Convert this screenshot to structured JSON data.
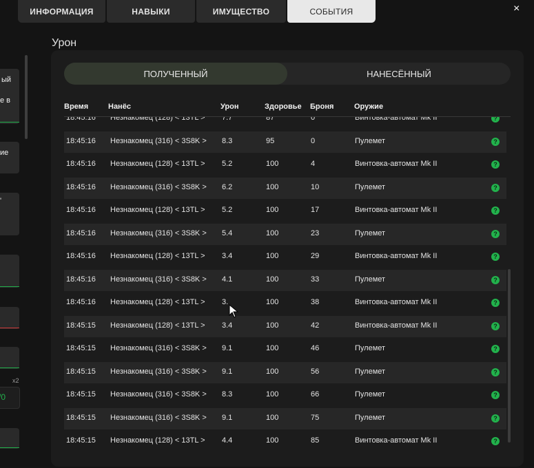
{
  "tabs": [
    {
      "label": "ИНФОРМАЦИЯ"
    },
    {
      "label": "НАВЫКИ"
    },
    {
      "label": "ИМУЩЕСТВО"
    },
    {
      "label": "СОБЫТИЯ",
      "active": true
    }
  ],
  "close_label": "×",
  "left_panel": {
    "snippets": [
      "ый",
      "е в",
      "ие",
      "'",
      "x2",
      "/0"
    ]
  },
  "section_title": "Урон",
  "segment": [
    {
      "label": "ПОЛУЧЕННЫЙ",
      "active": true
    },
    {
      "label": "НАНЕСЁННЫЙ",
      "active": false
    }
  ],
  "columns": [
    "Время",
    "Нанёс",
    "Урон",
    "Здоровье",
    "Броня",
    "Оружие"
  ],
  "rows": [
    {
      "time": "18:45:16",
      "attacker": "Незнакомец (128) < 13TL >",
      "damage": "7.7",
      "health": "87",
      "armor": "0",
      "weapon": "Винтовка-автомат Mk II"
    },
    {
      "time": "18:45:16",
      "attacker": "Незнакомец (316) < 3S8K >",
      "damage": "8.3",
      "health": "95",
      "armor": "0",
      "weapon": "Пулемет"
    },
    {
      "time": "18:45:16",
      "attacker": "Незнакомец (128) < 13TL >",
      "damage": "5.2",
      "health": "100",
      "armor": "4",
      "weapon": "Винтовка-автомат Mk II"
    },
    {
      "time": "18:45:16",
      "attacker": "Незнакомец (316) < 3S8K >",
      "damage": "6.2",
      "health": "100",
      "armor": "10",
      "weapon": "Пулемет"
    },
    {
      "time": "18:45:16",
      "attacker": "Незнакомец (128) < 13TL >",
      "damage": "5.2",
      "health": "100",
      "armor": "17",
      "weapon": "Винтовка-автомат Mk II"
    },
    {
      "time": "18:45:16",
      "attacker": "Незнакомец (316) < 3S8K >",
      "damage": "5.4",
      "health": "100",
      "armor": "23",
      "weapon": "Пулемет"
    },
    {
      "time": "18:45:16",
      "attacker": "Незнакомец (128) < 13TL >",
      "damage": "3.4",
      "health": "100",
      "armor": "29",
      "weapon": "Винтовка-автомат Mk II"
    },
    {
      "time": "18:45:16",
      "attacker": "Незнакомец (316) < 3S8K >",
      "damage": "4.1",
      "health": "100",
      "armor": "33",
      "weapon": "Пулемет"
    },
    {
      "time": "18:45:16",
      "attacker": "Незнакомец (128) < 13TL >",
      "damage": "3.",
      "health": "100",
      "armor": "38",
      "weapon": "Винтовка-автомат Mk II"
    },
    {
      "time": "18:45:15",
      "attacker": "Незнакомец (128) < 13TL >",
      "damage": "3.4",
      "health": "100",
      "armor": "42",
      "weapon": "Винтовка-автомат Mk II"
    },
    {
      "time": "18:45:15",
      "attacker": "Незнакомец (316) < 3S8K >",
      "damage": "9.1",
      "health": "100",
      "armor": "46",
      "weapon": "Пулемет"
    },
    {
      "time": "18:45:15",
      "attacker": "Незнакомец (316) < 3S8K >",
      "damage": "9.1",
      "health": "100",
      "armor": "56",
      "weapon": "Пулемет"
    },
    {
      "time": "18:45:15",
      "attacker": "Незнакомец (316) < 3S8K >",
      "damage": "8.3",
      "health": "100",
      "armor": "66",
      "weapon": "Пулемет"
    },
    {
      "time": "18:45:15",
      "attacker": "Незнакомец (316) < 3S8K >",
      "damage": "9.1",
      "health": "100",
      "armor": "75",
      "weapon": "Пулемет"
    },
    {
      "time": "18:45:15",
      "attacker": "Незнакомец (128) < 13TL >",
      "damage": "4.4",
      "health": "100",
      "armor": "85",
      "weapon": "Винтовка-автомат Mk II"
    }
  ],
  "row_icon": "question-icon",
  "colors": {
    "accent_green": "#22b24c",
    "active_tab": "#e8e8e8",
    "alert_red": "#d23a3a"
  }
}
